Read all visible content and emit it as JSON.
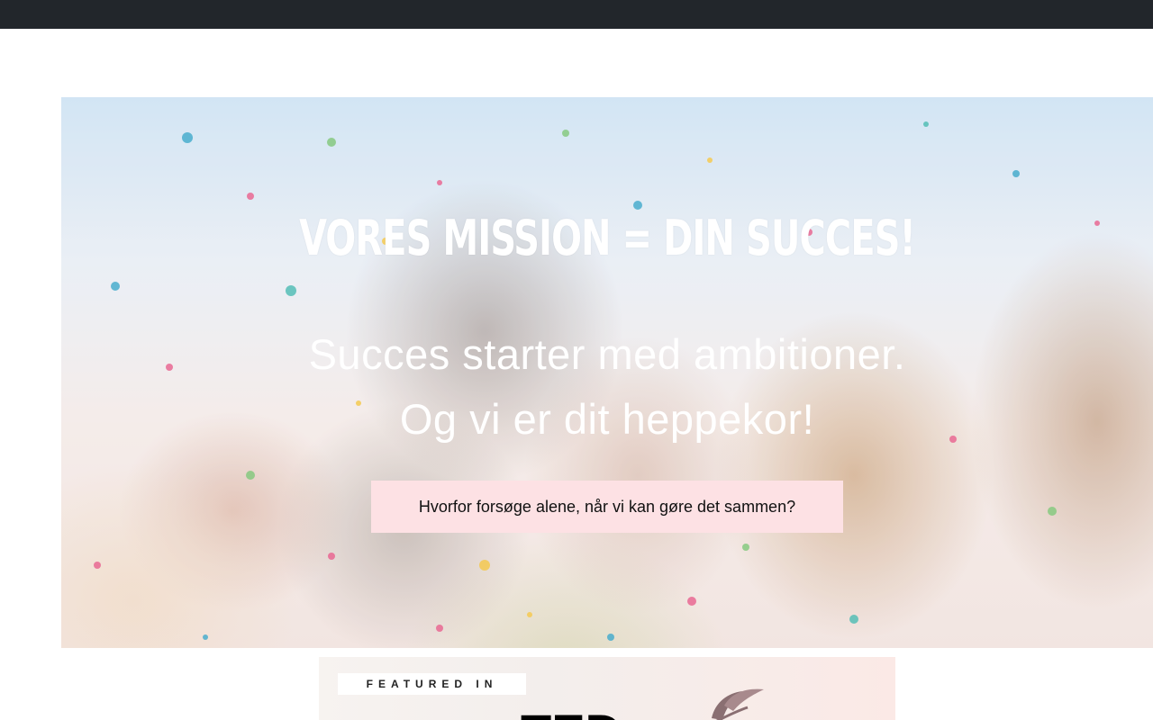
{
  "colors": {
    "topbar": "#22262b",
    "cta_background": "#fde1e4",
    "hero_text": "#ffffff"
  },
  "hero": {
    "title": "VORES MISSION = DIN SUCCES!",
    "line1": "Succes starter med ambitioner.",
    "line2": "Og vi er dit heppekor!",
    "cta_label": "Hvorfor forsøge alene, når vi kan gøre det sammen?",
    "image_icon": "celebration-photo"
  },
  "featured": {
    "label": "FEATURED IN",
    "logo1_text": "TED",
    "logo2_icon": "leaf-logo"
  }
}
